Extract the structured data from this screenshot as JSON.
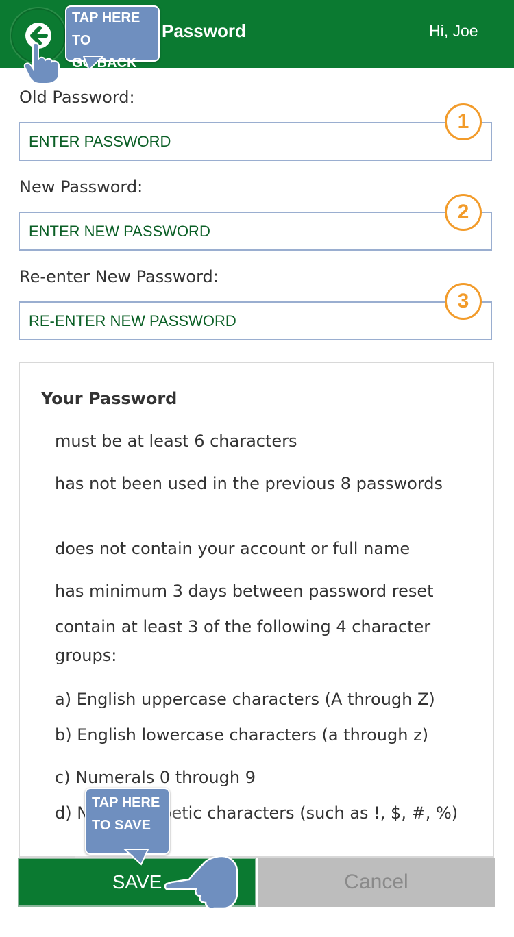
{
  "header": {
    "title": "Password",
    "greeting": "Hi, Joe",
    "back_icon": "arrow-left-icon",
    "background": "#0b7a31"
  },
  "callouts": {
    "back": [
      "TAP HERE TO",
      "GO BACK"
    ],
    "save": [
      "TAP HERE",
      "TO SAVE"
    ]
  },
  "form": {
    "old_label": "Old Password:",
    "old_placeholder": "ENTER PASSWORD",
    "new_label": "New Password:",
    "new_placeholder": "ENTER NEW PASSWORD",
    "reenter_label": "Re-enter New Password:",
    "reenter_placeholder": "RE-ENTER NEW PASSWORD"
  },
  "step_badges": [
    "1",
    "2",
    "3"
  ],
  "rules": {
    "title": "Your Password",
    "items": [
      "must be at least 6 characters",
      "has not been used in the previous 8 passwords",
      "does not contain your account or full name",
      "has minimum 3 days between password reset",
      "contain at least 3 of the following 4 character groups:",
      "a) English uppercase characters (A through Z)",
      "b) English lowercase characters (a through z)",
      "c) Numerals 0 through 9",
      "d) Non-alphabetic characters (such as !, $, #, %)"
    ]
  },
  "buttons": {
    "save": "SAVE",
    "cancel": "Cancel"
  },
  "colors": {
    "accent_green": "#0b7a31",
    "callout_blue": "#6f8fbf",
    "badge_orange": "#f29b2a",
    "cancel_gray": "#bdbdbd"
  }
}
